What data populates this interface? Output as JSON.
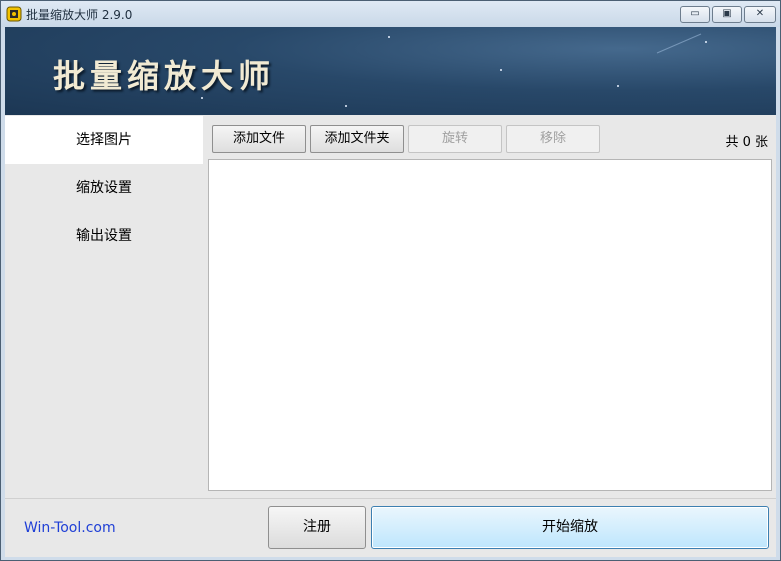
{
  "window": {
    "title": "批量缩放大师 2.9.0",
    "controls": {
      "minimize": "▭",
      "maximize": "▣",
      "close": "✕"
    }
  },
  "banner": {
    "title": "批量缩放大师"
  },
  "sidebar": {
    "items": [
      {
        "label": "选择图片",
        "active": true
      },
      {
        "label": "缩放设置",
        "active": false
      },
      {
        "label": "输出设置",
        "active": false
      }
    ]
  },
  "toolbar": {
    "add_file": "添加文件",
    "add_folder": "添加文件夹",
    "rotate": "旋转",
    "remove": "移除"
  },
  "status": {
    "count": "共 0 张"
  },
  "file_list": {
    "items": []
  },
  "footer": {
    "link": "Win-Tool.com",
    "register": "注册",
    "start": "开始缩放"
  },
  "colors": {
    "banner_bg": "#284869",
    "banner_text": "#f1ead3",
    "link": "#1f3fd6",
    "primary_button": "#bee6fd",
    "panel_bg": "#e8e8e8"
  },
  "icons": {
    "app": "app-logo-icon",
    "minimize": "minimize-icon",
    "maximize": "maximize-icon",
    "close": "close-icon"
  }
}
